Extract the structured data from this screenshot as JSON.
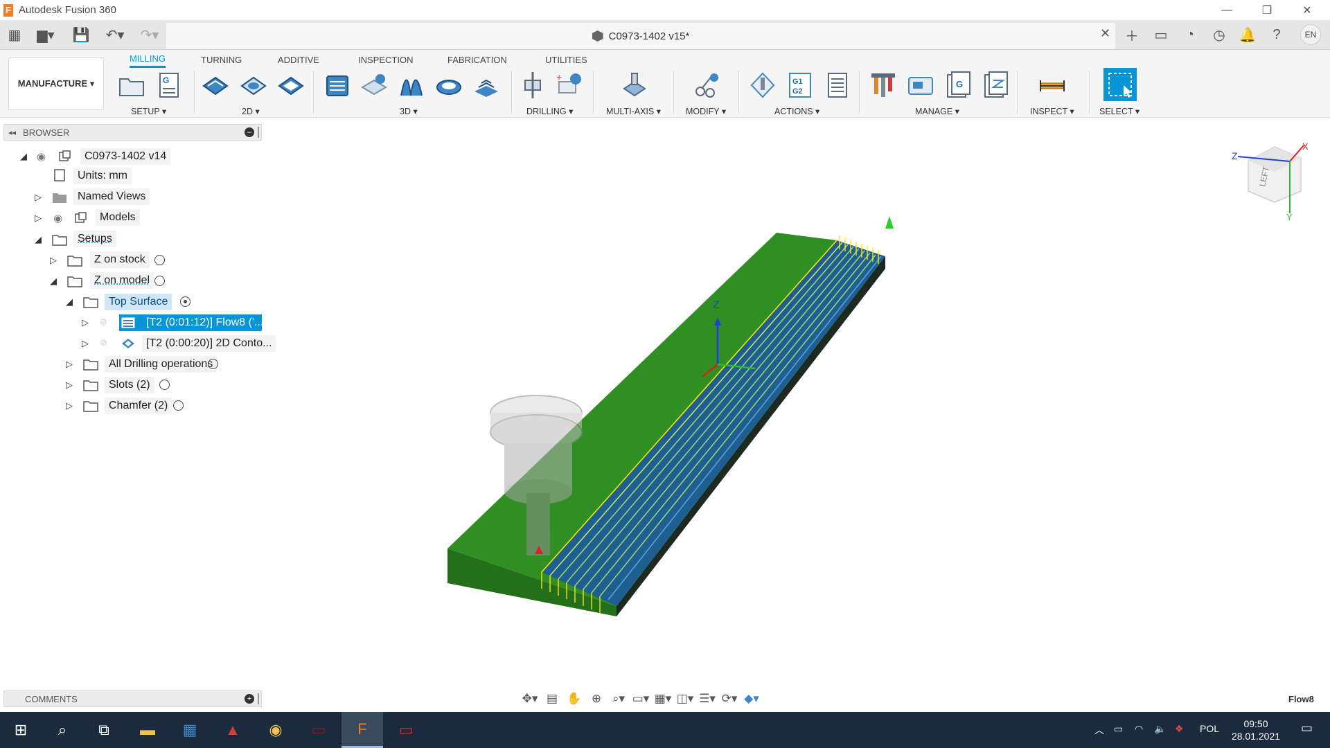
{
  "window": {
    "title": "Autodesk Fusion 360",
    "logo_letter": "F"
  },
  "document": {
    "title": "C0973-1402 v15*"
  },
  "account": {
    "initials": "EN"
  },
  "ribbon": {
    "workspace": "MANUFACTURE ▾",
    "tabs": [
      "MILLING",
      "TURNING",
      "ADDITIVE",
      "INSPECTION",
      "FABRICATION",
      "UTILITIES"
    ],
    "groups": [
      "SETUP ▾",
      "2D ▾",
      "3D ▾",
      "DRILLING ▾",
      "MULTI-AXIS ▾",
      "MODIFY ▾",
      "ACTIONS ▾",
      "MANAGE ▾",
      "INSPECT ▾",
      "SELECT ▾"
    ]
  },
  "browser": {
    "title": "BROWSER",
    "rows": [
      "C0973-1402 v14",
      "Units: mm",
      "Named Views",
      "Models",
      "Setups",
      "Z on stock",
      "Z on model",
      "Top Surface",
      "[T2 (0:01:12)] Flow8 ('...",
      "[T2 (0:00:20)] 2D Conto...",
      "All Drilling operations",
      "Slots (2)",
      "Chamfer (2)"
    ]
  },
  "comments": {
    "title": "COMMENTS"
  },
  "status": {
    "right_text": "Flow8"
  },
  "viewcube": {
    "face": "LEFT",
    "axis_z": "Z",
    "axis_x": "X",
    "axis_y": "Y"
  },
  "viewport": {
    "axis_label": "Z"
  },
  "taskbar": {
    "language": "POL",
    "time": "09:50",
    "date": "28.01.2021"
  }
}
